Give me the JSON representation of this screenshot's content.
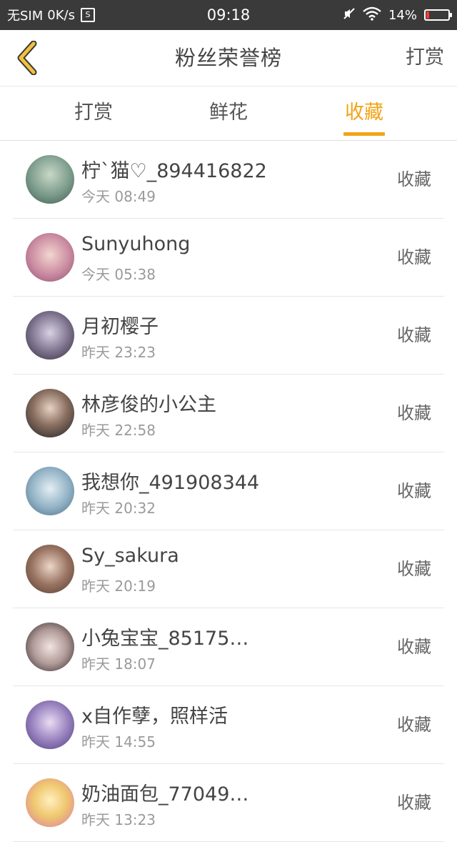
{
  "status_bar": {
    "carrier": "无SIM",
    "speed": "0K/s",
    "time": "09:18",
    "battery": "14%",
    "battery_level": 0.14,
    "icons": [
      "sim-icon",
      "mute-icon",
      "wifi-icon",
      "battery-icon"
    ]
  },
  "header": {
    "title": "粉丝荣誉榜",
    "action_label": "打赏",
    "back_icon": "chevron-left-icon",
    "accent_color": "#f2a417"
  },
  "tabs": [
    {
      "label": "打赏",
      "active": false
    },
    {
      "label": "鲜花",
      "active": false
    },
    {
      "label": "收藏",
      "active": true
    }
  ],
  "list": [
    {
      "name": "柠`猫♡_894416822",
      "time": "今天 08:49",
      "action": "收藏"
    },
    {
      "name": "Sunyuhong",
      "time": "今天 05:38",
      "action": "收藏"
    },
    {
      "name": "月初樱子",
      "time": "昨天 23:23",
      "action": "收藏"
    },
    {
      "name": "林彦俊的小公主",
      "time": "昨天 22:58",
      "action": "收藏"
    },
    {
      "name": "我想你_491908344",
      "time": "昨天 20:32",
      "action": "收藏"
    },
    {
      "name": "Sy_sakura",
      "time": "昨天 20:19",
      "action": "收藏"
    },
    {
      "name": "小兔宝宝_85175…",
      "time": "昨天 18:07",
      "action": "收藏"
    },
    {
      "name": "x自作孽，照样活",
      "time": "昨天 14:55",
      "action": "收藏"
    },
    {
      "name": "奶油面包_77049…",
      "time": "昨天 13:23",
      "action": "收藏"
    }
  ]
}
